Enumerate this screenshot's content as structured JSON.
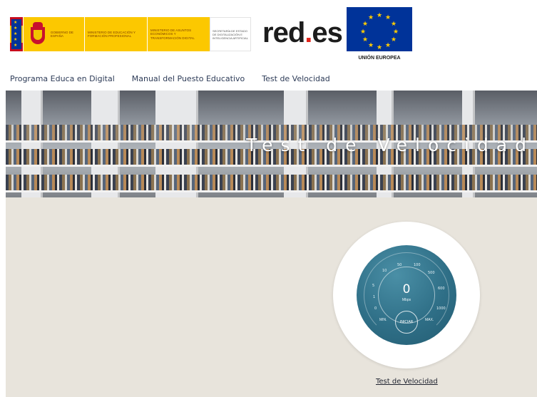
{
  "header": {
    "gov": {
      "gobierno": "GOBIERNO DE ESPAÑA",
      "ministerio_educacion": "MINISTERIO DE EDUCACIÓN Y FORMACIÓN PROFESIONAL",
      "ministerio_economia": "MINISTERIO DE ASUNTOS ECONÓMICOS Y TRANSFORMACIÓN DIGITAL",
      "secretaria": "SECRETARÍA DE ESTADO DE DIGITALIZACIÓN E INTELIGENCIA ARTIFICIAL"
    },
    "redes_main": "red",
    "redes_dot": ".",
    "redes_suffix": "es",
    "eu_label": "UNIÓN EUROPEA"
  },
  "nav": {
    "items": [
      {
        "label": "Programa Educa en Digital"
      },
      {
        "label": "Manual del Puesto Educativo"
      },
      {
        "label": "Test de Velocidad"
      }
    ]
  },
  "banner": {
    "title": "Test de Velocidad"
  },
  "gauge": {
    "value": "0",
    "unit": "Mbps",
    "start_label": "INICIAR",
    "min_label": "MIN.",
    "max_label": "MAX.",
    "ticks": [
      "0",
      "1",
      "5",
      "10",
      "50",
      "100",
      "500",
      "600",
      "1000"
    ]
  },
  "footer_link": "Test de Velocidad",
  "colors": {
    "nav_text": "#2d3b57",
    "gauge_face": "#2f6f87",
    "main_bg": "#e8e4dc",
    "eu_blue": "#003399"
  }
}
